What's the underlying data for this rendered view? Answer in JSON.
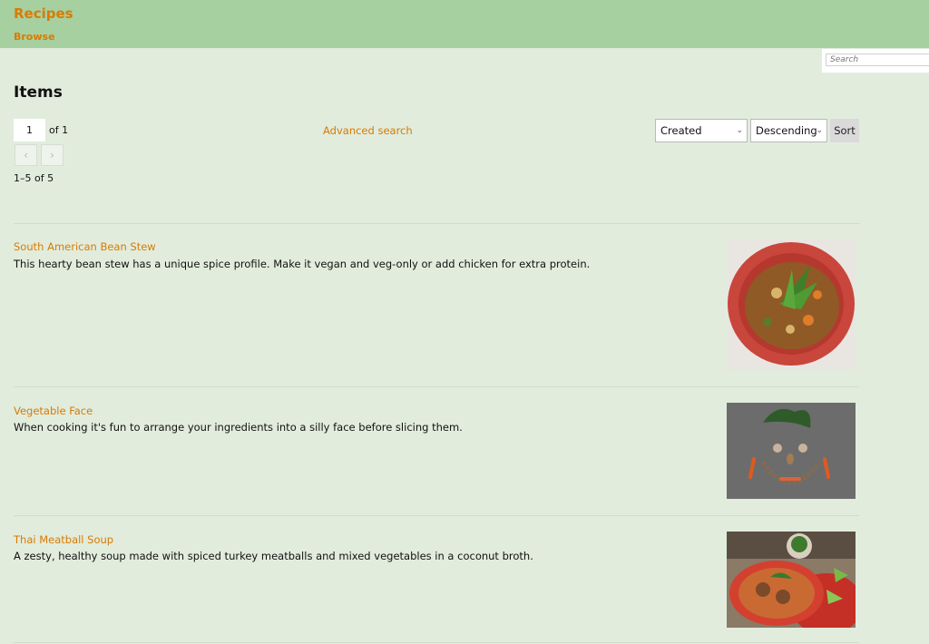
{
  "header": {
    "site_title": "Recipes",
    "nav_browse": "Browse"
  },
  "search": {
    "placeholder": "Search"
  },
  "page": {
    "title": "Items",
    "current_page": "1",
    "of_pages": "of 1",
    "prev_icon": "‹",
    "next_icon": "›",
    "advanced_search": "Advanced search",
    "sort_field": "Created",
    "sort_order": "Descending",
    "sort_button": "Sort",
    "results_count": "1–5 of 5"
  },
  "items": [
    {
      "title": "South American Bean Stew",
      "description": "This hearty bean stew has a unique spice profile. Make it vegan and veg-only or add chicken for extra protein."
    },
    {
      "title": "Vegetable Face",
      "description": "When cooking it's fun to arrange your ingredients into a silly face before slicing them."
    },
    {
      "title": "Thai Meatball Soup",
      "description": "A zesty, healthy soup made with spiced turkey meatballs and mixed vegetables in a coconut broth."
    }
  ],
  "colors": {
    "accent": "#d97b00",
    "header_bg": "#a7d0a0",
    "page_bg": "#e1ecdd"
  }
}
